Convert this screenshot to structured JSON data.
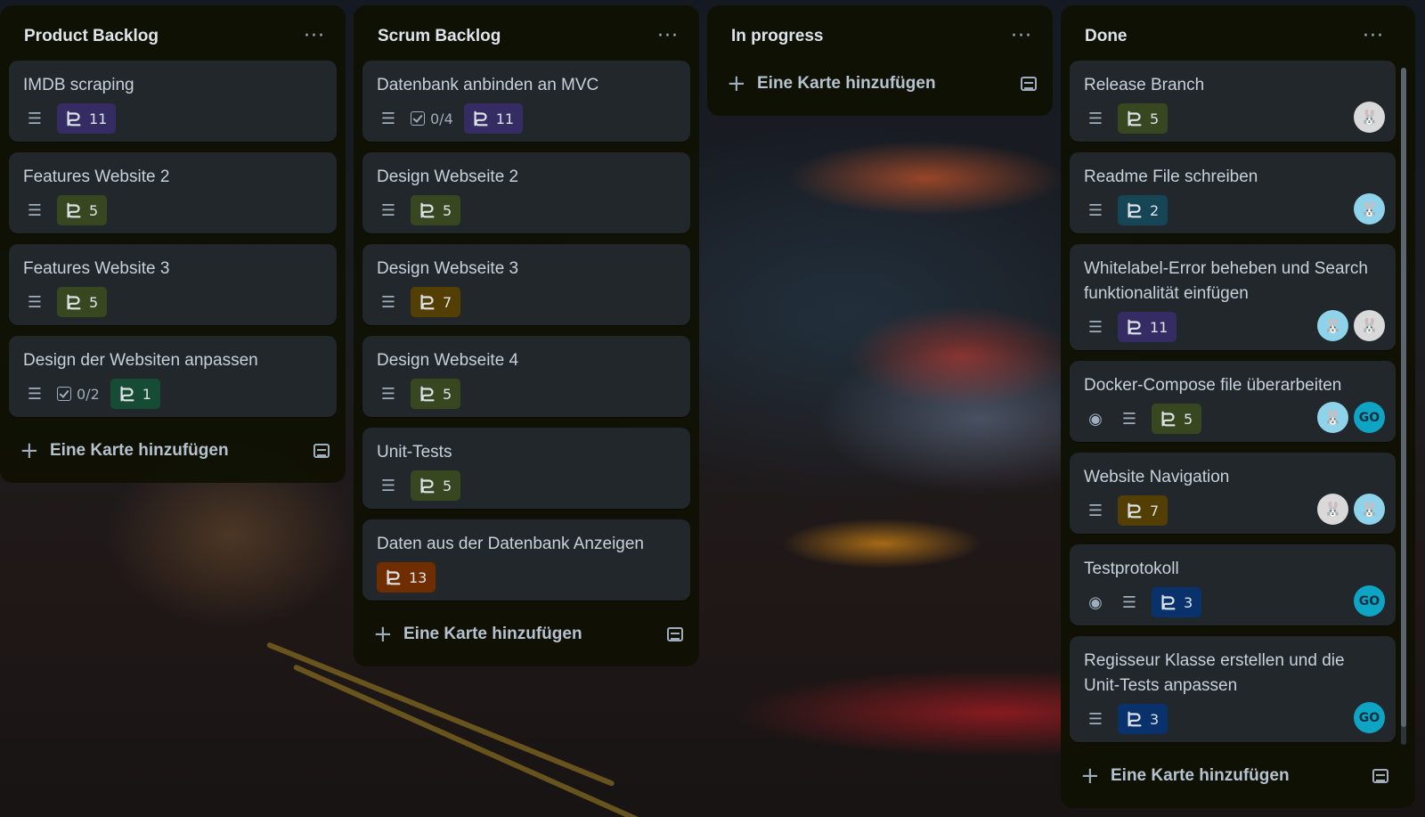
{
  "lists": [
    {
      "title": "Product Backlog",
      "menu": "···",
      "add_label": "Eine Karte hinzufügen",
      "cards": [
        {
          "title": "IMDB scraping",
          "points": "11",
          "color": "#352c63"
        },
        {
          "title": "Features Website 2",
          "points": "5",
          "color": "#37471f"
        },
        {
          "title": "Features Website 3",
          "points": "5",
          "color": "#37471f"
        },
        {
          "title": "Design der Websiten anpassen",
          "checklist": "0/2",
          "points": "1",
          "color": "#164b35"
        }
      ]
    },
    {
      "title": "Scrum Backlog",
      "menu": "···",
      "add_label": "Eine Karte hinzufügen",
      "cards": [
        {
          "title": "Datenbank anbinden an MVC",
          "checklist": "0/4",
          "points": "11",
          "color": "#352c63"
        },
        {
          "title": "Design Webseite 2",
          "points": "5",
          "color": "#37471f"
        },
        {
          "title": "Design Webseite 3",
          "points": "7",
          "color": "#533f04"
        },
        {
          "title": "Design Webseite 4",
          "points": "5",
          "color": "#37471f"
        },
        {
          "title": "Unit-Tests",
          "points": "5",
          "color": "#37471f"
        },
        {
          "title": "Daten aus der Datenbank Anzeigen",
          "points": "13",
          "color": "#702e00"
        }
      ]
    },
    {
      "title": "In progress",
      "menu": "···",
      "add_label": "Eine Karte hinzufügen",
      "cards": []
    },
    {
      "title": "Done",
      "menu": "···",
      "add_label": "Eine Karte hinzufügen",
      "cards": [
        {
          "title": "Release Branch",
          "points": "5",
          "color": "#37471f",
          "avatars": [
            "bunny2"
          ]
        },
        {
          "title": "Readme File schreiben",
          "points": "2",
          "color": "#164555",
          "avatars": [
            "bunny"
          ]
        },
        {
          "title": "Whitelabel-Error beheben und Search funktionalität einfügen",
          "points": "11",
          "color": "#352c63",
          "avatars": [
            "bunny",
            "bunny2"
          ]
        },
        {
          "title": "Docker-Compose file überarbeiten",
          "watch": true,
          "points": "5",
          "color": "#37471f",
          "avatars": [
            "bunny",
            "GO"
          ]
        },
        {
          "title": "Website Navigation",
          "points": "7",
          "color": "#533f04",
          "avatars": [
            "bunny2",
            "bunny"
          ]
        },
        {
          "title": "Testprotokoll",
          "watch": true,
          "points": "3",
          "color": "#09326c",
          "avatars": [
            "GO"
          ]
        },
        {
          "title": "Regisseur Klasse erstellen und die Unit-Tests anpassen",
          "points": "3",
          "color": "#09326c",
          "avatars": [
            "GO"
          ]
        }
      ]
    }
  ]
}
